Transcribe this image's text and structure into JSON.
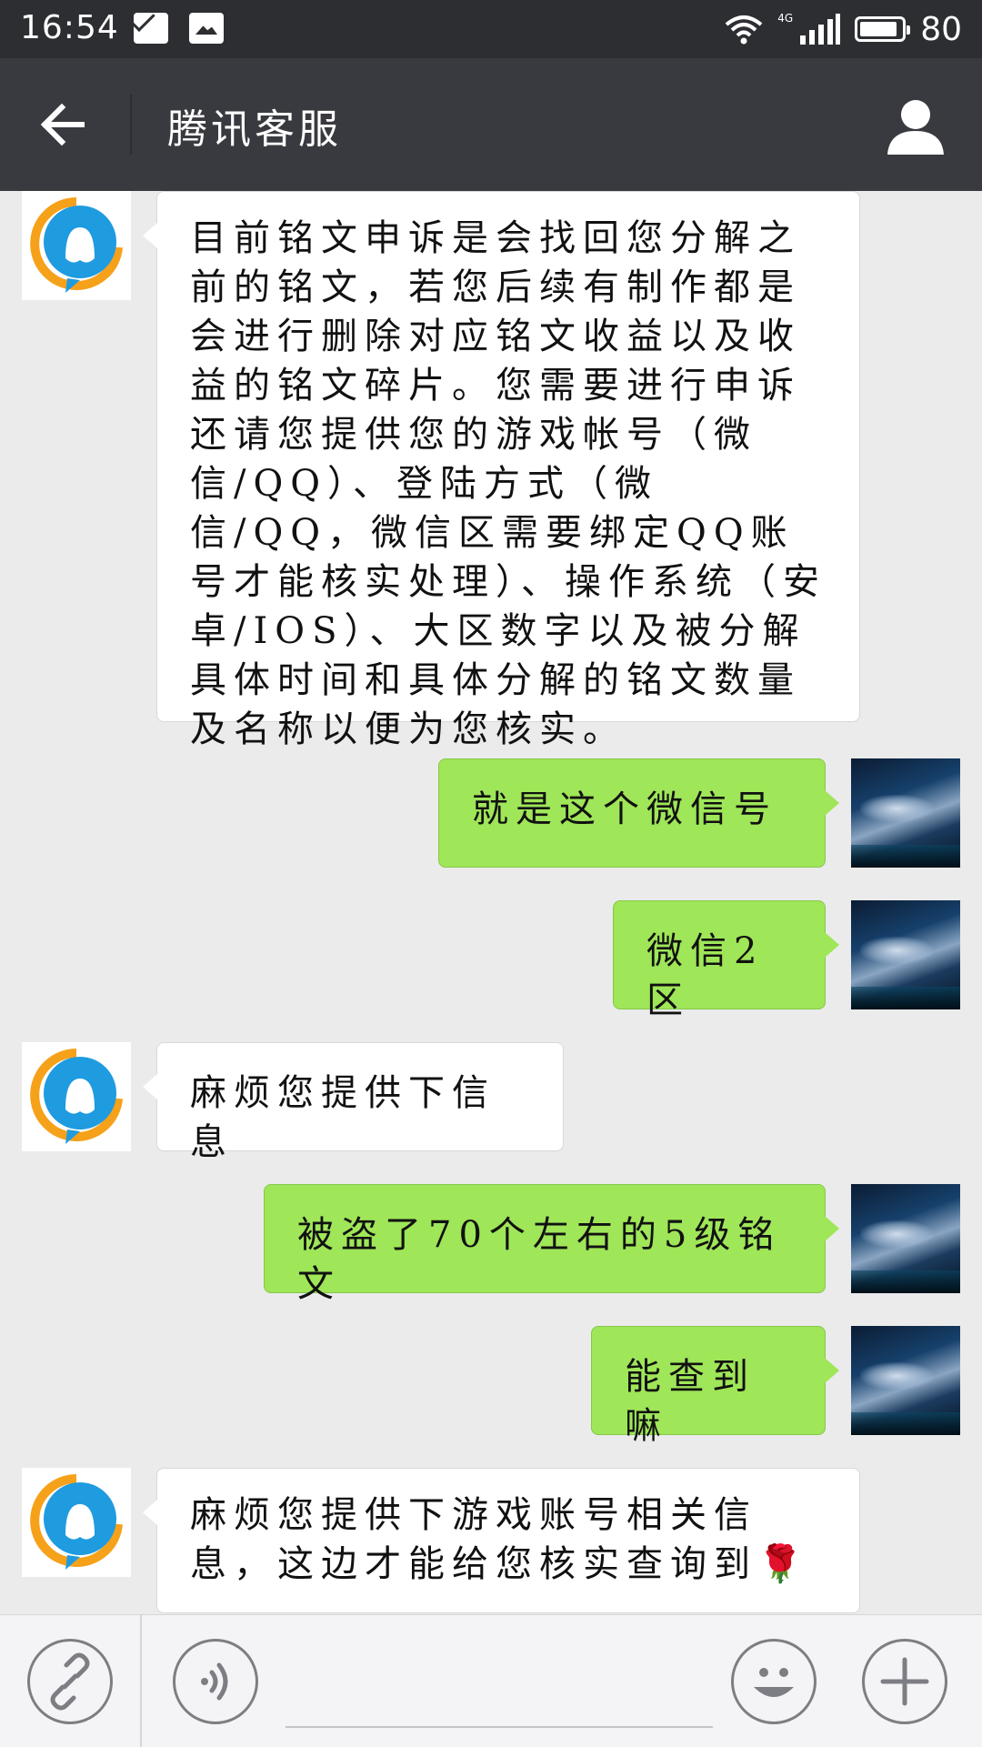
{
  "status_bar": {
    "time": "16:54",
    "network": "4G",
    "battery": "80",
    "icons": [
      "mail-notification-icon",
      "image-notification-icon",
      "wifi-icon",
      "signal-icon",
      "battery-icon"
    ]
  },
  "header": {
    "title": "腾讯客服",
    "back_icon": "arrow-left-icon",
    "profile_icon": "person-icon"
  },
  "messages": [
    {
      "side": "left",
      "sender": "tencent-service",
      "text": "目前铭文申诉是会找回您分解之前的铭文，若您后续有制作都是会进行删除对应铭文收益以及收益的铭文碎片。您需要进行申诉还请您提供您的游戏帐号（微信/QQ）、登陆方式（微信/QQ，微信区需要绑定QQ账号才能核实处理）、操作系统（安卓/IOS）、大区数字以及被分解具体时间和具体分解的铭文数量及名称以便为您核实。"
    },
    {
      "side": "right",
      "sender": "user",
      "text": "就是这个微信号"
    },
    {
      "side": "right",
      "sender": "user",
      "text": "微信2区"
    },
    {
      "side": "left",
      "sender": "tencent-service",
      "text": "麻烦您提供下信息"
    },
    {
      "side": "right",
      "sender": "user",
      "text": "被盗了70个左右的5级铭文"
    },
    {
      "side": "right",
      "sender": "user",
      "text": "能查到嘛"
    },
    {
      "side": "left",
      "sender": "tencent-service",
      "text": "麻烦您提供下游戏账号相关信息，这边才能给您核实查询到🌹"
    }
  ],
  "input_bar": {
    "icons": [
      "link-icon",
      "voice-icon",
      "emoji-icon",
      "plus-icon"
    ]
  },
  "colors": {
    "status_bar": "#2d2e32",
    "header": "#393a3f",
    "chat_bg": "#ebebeb",
    "bubble_self": "#9fe658",
    "bubble_other": "#ffffff",
    "qq_blue": "#1f9be0",
    "qq_orange": "#f6a11a"
  }
}
